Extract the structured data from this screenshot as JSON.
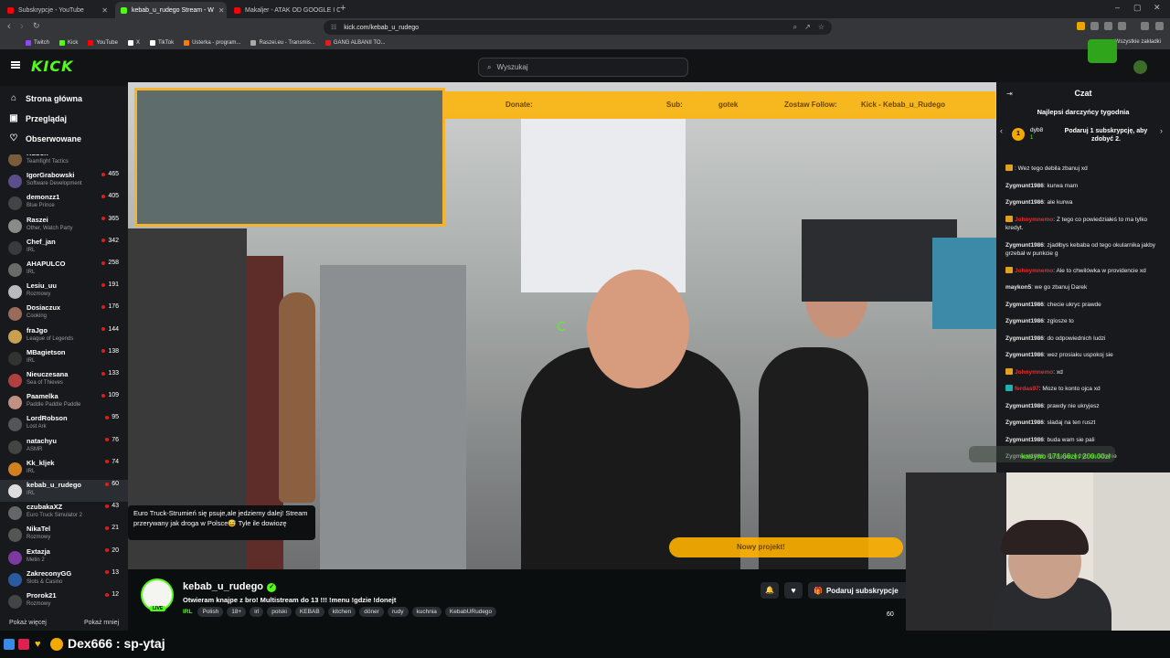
{
  "browser": {
    "tabs": [
      {
        "title": "Subskrypcje - YouTube",
        "color": "#ff0000"
      },
      {
        "title": "kebab_u_rudego Stream - W",
        "color": "#53fc18"
      },
      {
        "title": "Makaljer - ATAK OD GOOGLE I CHIP",
        "color": "#ff0000"
      }
    ],
    "url": "kick.com/kebab_u_rudego",
    "bookmarks": [
      "Twitch",
      "Kick",
      "YouTube",
      "X",
      "TikTok",
      "Usterka - program...",
      "Raszei.eu - Transmis...",
      "GANG ALBANII TO..."
    ],
    "all_bookmarks": "Wszystkie zakładki"
  },
  "kick": {
    "logo": "KICK",
    "search_placeholder": "Wyszukaj",
    "nav": [
      {
        "label": "Strona główna",
        "icon": "home-icon"
      },
      {
        "label": "Przeglądaj",
        "icon": "browse-icon"
      },
      {
        "label": "Obserwowane",
        "icon": "heart-icon"
      }
    ],
    "following": [
      {
        "name": "Kubon",
        "category": "Teamfight Tactics",
        "viewers": "503",
        "color": "#7a5c3a"
      },
      {
        "name": "IgorGrabowski",
        "category": "Software Development",
        "viewers": "465",
        "color": "#5b4e8a"
      },
      {
        "name": "demonzz1",
        "category": "Blue Prince",
        "viewers": "405",
        "color": "#444"
      },
      {
        "name": "Raszei",
        "category": "Other, Watch Party",
        "viewers": "365",
        "color": "#8a8a8a"
      },
      {
        "name": "Chef_jan",
        "category": "IRL",
        "viewers": "342",
        "color": "#3a3a3a"
      },
      {
        "name": "AHAPULCO",
        "category": "IRL",
        "viewers": "258",
        "color": "#6a6a6a"
      },
      {
        "name": "Lesiu_uu",
        "category": "Rozmowy",
        "viewers": "191",
        "color": "#bbb"
      },
      {
        "name": "Dosiaczux",
        "category": "Cooking",
        "viewers": "176",
        "color": "#9a6a5a"
      },
      {
        "name": "fraJgo",
        "category": "League of Legends",
        "viewers": "144",
        "color": "#c8a050"
      },
      {
        "name": "MBagietson",
        "category": "IRL",
        "viewers": "138",
        "color": "#333"
      },
      {
        "name": "Nieuczesana",
        "category": "Sea of Thieves",
        "viewers": "133",
        "color": "#b04040"
      },
      {
        "name": "Paamelka",
        "category": "Paddle Paddle Paddle",
        "viewers": "109",
        "color": "#c09080"
      },
      {
        "name": "LordRobson",
        "category": "Lost Ark",
        "viewers": "95",
        "color": "#555"
      },
      {
        "name": "natachyu",
        "category": "ASMR",
        "viewers": "76",
        "color": "#444"
      },
      {
        "name": "Kk_kljek",
        "category": "IRL",
        "viewers": "74",
        "color": "#d08020"
      },
      {
        "name": "kebab_u_rudego",
        "category": "IRL",
        "viewers": "60",
        "color": "#ddd"
      },
      {
        "name": "czubakaXZ",
        "category": "Euro Truck Simulator 2",
        "viewers": "43",
        "color": "#666"
      },
      {
        "name": "NikaTel",
        "category": "Rozmowy",
        "viewers": "21",
        "color": "#555"
      },
      {
        "name": "Extazja",
        "category": "Metin 2",
        "viewers": "20",
        "color": "#7a3aa0"
      },
      {
        "name": "ZakreconyGG",
        "category": "Slots & Casino",
        "viewers": "13",
        "color": "#2a5aa0"
      },
      {
        "name": "Prorok21",
        "category": "Rozmowy",
        "viewers": "12",
        "color": "#444"
      }
    ],
    "show_more": "Pokaż więcej",
    "show_less": "Pokaż mniej"
  },
  "stream": {
    "overlay_donate": "Donate:",
    "overlay_sub": "Sub:",
    "overlay_sub_name": "gotek",
    "overlay_follow": "Zostaw Follow:",
    "overlay_follow_val": "Kick - Kebab_u_Rudego",
    "project_label": "Nowy projekt!",
    "tooltip": "Euro Truck-Strumień się psuje,ale jedziemy dalej! Stream przerywany jak droga w Polsce😅 Tyle ile dowiozę",
    "streamer": "kebab_u_rudego",
    "live": "LIVE",
    "title": "Otwieram knajpe z bro! Multistream do 13 !!! !menu !gdzie !donejt",
    "category": "IRL",
    "tags": [
      "Polish",
      "18+",
      "irl",
      "polski",
      "KEBAB",
      "kitchen",
      "döner",
      "rudy",
      "kuchnia",
      "KebabURudego"
    ],
    "subscribe": "Podaruj subskrypcje",
    "viewers": "60"
  },
  "chat": {
    "title": "Czat",
    "gift_title": "Najlepsi darczyńcy tygodnia",
    "gift_user": "dyb8",
    "gift_count": "1",
    "gift_rank": "1",
    "gift_cta": "Podaruj 1 subskrypcję, aby zdobyć 2.",
    "pinned": "kasyno 171.66zł / 200.00zł",
    "messages": [
      {
        "user": "",
        "text": ": Wez tego debila zbanuj xd",
        "color": "#e03030",
        "badge": "#e0a020"
      },
      {
        "user": "Zygmunt1986",
        "text": ": kurwa mam",
        "color": "#e8e8e8",
        "badge": ""
      },
      {
        "user": "Zygmunt1986",
        "text": ": ale kurwa",
        "color": "#e8e8e8",
        "badge": ""
      },
      {
        "user": "Johnymnemo",
        "text": ": Z tego co powiedziałeś to ma tylko kredyt.",
        "color": "#e03030",
        "badge": "#e0a020"
      },
      {
        "user": "Zygmunt1986",
        "text": ": zjadłbys kebaba od tego okularnika jakby grzebał w punkcie g",
        "color": "#e8e8e8",
        "badge": ""
      },
      {
        "user": "Johnymnemo",
        "text": ": Ale to chwilówka w providencie xd",
        "color": "#e03030",
        "badge": "#e0a020"
      },
      {
        "user": "maykon5",
        "text": ": we go zbanuj Darek",
        "color": "#e8e8e8",
        "badge": ""
      },
      {
        "user": "Zygmunt1986",
        "text": ": checie ukryc prawde",
        "color": "#e8e8e8",
        "badge": ""
      },
      {
        "user": "Zygmunt1986",
        "text": ": zglosze to",
        "color": "#e8e8e8",
        "badge": ""
      },
      {
        "user": "Zygmunt1986",
        "text": ": do odpowiednich ludzi",
        "color": "#e8e8e8",
        "badge": ""
      },
      {
        "user": "Zygmunt1986",
        "text": ": wez prosiaku uspokoj sie",
        "color": "#e8e8e8",
        "badge": ""
      },
      {
        "user": "Johnymnemo",
        "text": ": xd",
        "color": "#e03030",
        "badge": "#e0a020"
      },
      {
        "user": "ferdas97",
        "text": ": Moze to konto ojca xd",
        "color": "#e03030",
        "badge": "#20b0b0"
      },
      {
        "user": "Zygmunt1986",
        "text": ": prawdy nie ukryjesz",
        "color": "#e8e8e8",
        "badge": ""
      },
      {
        "user": "Zygmunt1986",
        "text": ": sladaj na ten ruszt",
        "color": "#e8e8e8",
        "badge": ""
      },
      {
        "user": "Zygmunt1986",
        "text": ": buda wam sie pali",
        "color": "#e8e8e8",
        "badge": ""
      },
      {
        "user": "Zygmunt1986",
        "text": ": kurwa jak grzyb na scianie",
        "color": "#e8e8e8",
        "badge": ""
      }
    ]
  },
  "bottom_text": "Dex666 : sp-ytaj"
}
